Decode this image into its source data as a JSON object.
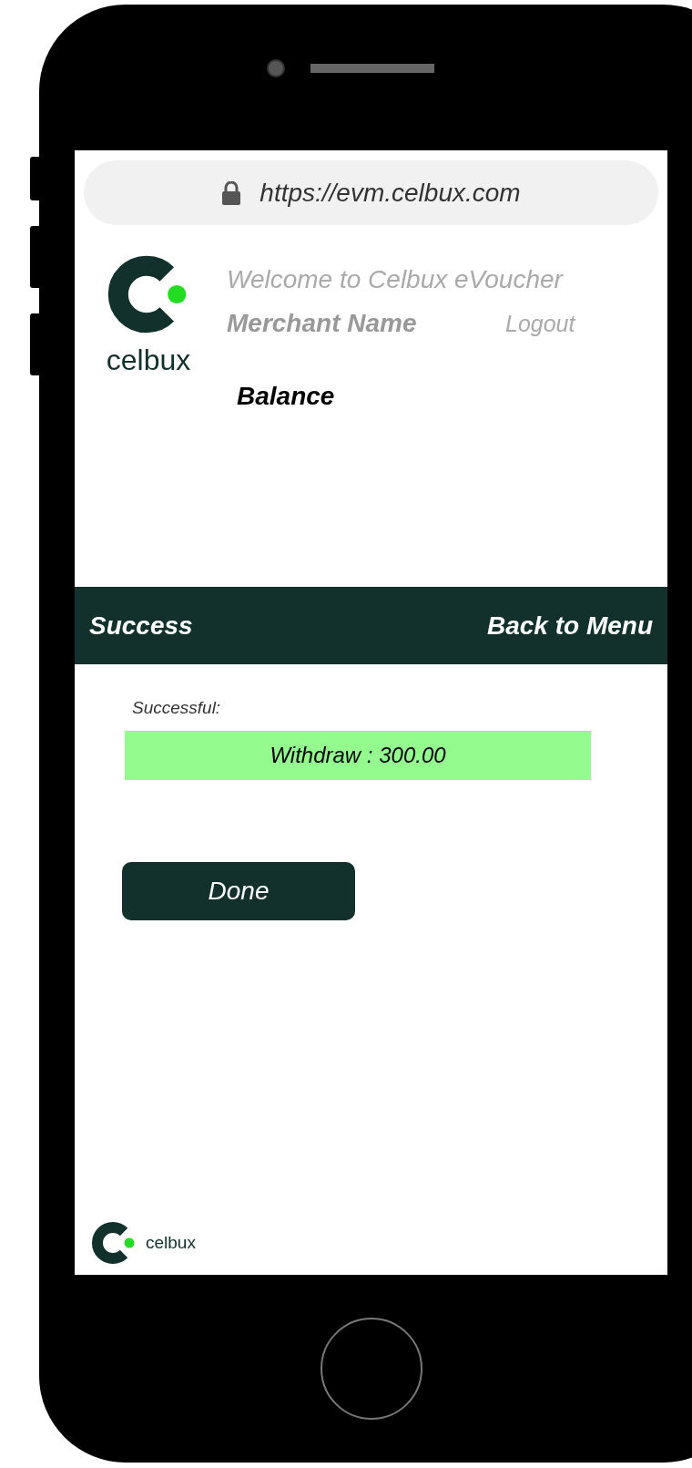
{
  "address_bar": {
    "url": "https://evm.celbux.com"
  },
  "header": {
    "logo_text": "celbux",
    "welcome": "Welcome to Celbux eVoucher",
    "merchant_name": "Merchant Name",
    "logout": "Logout",
    "balance": "Balance"
  },
  "title_bar": {
    "title": "Success",
    "back_link": "Back to Menu"
  },
  "result": {
    "label": "Successful:",
    "message": "Withdraw : 300.00"
  },
  "done_button": "Done",
  "footer": {
    "logo_text": "celbux"
  }
}
